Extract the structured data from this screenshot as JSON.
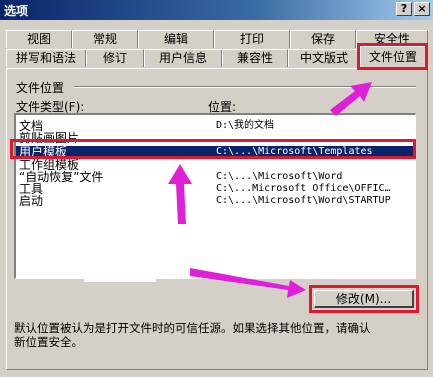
{
  "window": {
    "title": "选项",
    "help_button": "?",
    "close_button": "×"
  },
  "tabs_row1": [
    "视图",
    "常规",
    "编辑",
    "打印",
    "保存",
    "安全性"
  ],
  "tabs_row2": [
    "拼写和语法",
    "修订",
    "用户信息",
    "兼容性",
    "中文版式",
    "文件位置"
  ],
  "active_tab": "文件位置",
  "group": {
    "title": "文件位置",
    "col_type_label": "文件类型(F):",
    "col_location_label": "位置:"
  },
  "file_locations": [
    {
      "type": "文档",
      "location": "D:\\我的文档"
    },
    {
      "type": "剪贴画图片",
      "location": ""
    },
    {
      "type": "用户模板",
      "location": "C:\\...\\Microsoft\\Templates"
    },
    {
      "type": "工作组模板",
      "location": ""
    },
    {
      "type": "“自动恢复”文件",
      "location": "C:\\...\\Microsoft\\Word"
    },
    {
      "type": "工具",
      "location": "C:\\...Microsoft Office\\OFFIC…"
    },
    {
      "type": "启动",
      "location": "C:\\...\\Microsoft\\Word\\STARTUP"
    }
  ],
  "selected_index": 2,
  "modify_button": "修改(M)...",
  "info_text_line1": "默认位置被认为是打开文件时的可信任源。如果选择其他位置，请确认",
  "info_text_line2": "新位置安全。",
  "colors": {
    "highlight_box": "#e0182d",
    "arrow": "#e020d8",
    "selection": "#0a246a"
  }
}
